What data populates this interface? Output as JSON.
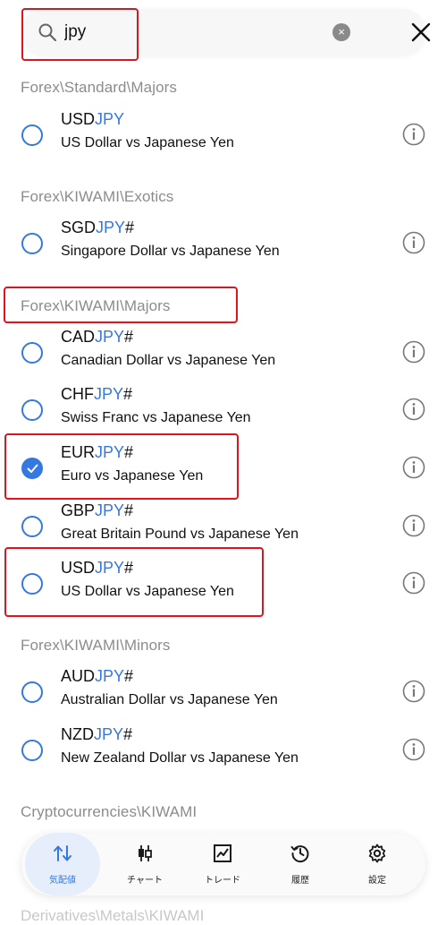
{
  "search": {
    "value": "jpy",
    "clear": "×"
  },
  "sections": [
    {
      "header": "Forex\\Standard\\Majors",
      "items": [
        {
          "base": "USD",
          "quote": "JPY",
          "suffix": "",
          "description": "US Dollar vs Japanese Yen",
          "selected": false
        }
      ]
    },
    {
      "header": "Forex\\KIWAMI\\Exotics",
      "items": [
        {
          "base": "SGD",
          "quote": "JPY",
          "suffix": "#",
          "description": "Singapore Dollar vs Japanese Yen",
          "selected": false
        }
      ]
    },
    {
      "header": "Forex\\KIWAMI\\Majors",
      "items": [
        {
          "base": "CAD",
          "quote": "JPY",
          "suffix": "#",
          "description": "Canadian Dollar vs Japanese Yen",
          "selected": false
        },
        {
          "base": "CHF",
          "quote": "JPY",
          "suffix": "#",
          "description": "Swiss Franc vs Japanese Yen",
          "selected": false
        },
        {
          "base": "EUR",
          "quote": "JPY",
          "suffix": "#",
          "description": "Euro vs Japanese Yen",
          "selected": true
        },
        {
          "base": "GBP",
          "quote": "JPY",
          "suffix": "#",
          "description": "Great Britain Pound vs Japanese Yen",
          "selected": false
        },
        {
          "base": "USD",
          "quote": "JPY",
          "suffix": "#",
          "description": "US Dollar vs Japanese Yen",
          "selected": false
        }
      ]
    },
    {
      "header": "Forex\\KIWAMI\\Minors",
      "items": [
        {
          "base": "AUD",
          "quote": "JPY",
          "suffix": "#",
          "description": "Australian Dollar vs Japanese Yen",
          "selected": false
        },
        {
          "base": "NZD",
          "quote": "JPY",
          "suffix": "#",
          "description": "New Zealand Dollar vs Japanese Yen",
          "selected": false
        }
      ]
    },
    {
      "header": "Cryptocurrencies\\KIWAMI",
      "items": []
    }
  ],
  "partial_header": "Derivatives\\Metals\\KIWAMI",
  "tabs": [
    {
      "label": "気配値",
      "icon": "quotes-arrows-icon",
      "active": true
    },
    {
      "label": "チャート",
      "icon": "candlestick-chart-icon",
      "active": false
    },
    {
      "label": "トレード",
      "icon": "trade-chart-icon",
      "active": false
    },
    {
      "label": "履歴",
      "icon": "history-clock-icon",
      "active": false
    },
    {
      "label": "設定",
      "icon": "settings-gear-icon",
      "active": false
    }
  ],
  "colors": {
    "accent": "#3478e0",
    "highlight_box": "#e0141e",
    "section_header": "#8c8c8c"
  }
}
